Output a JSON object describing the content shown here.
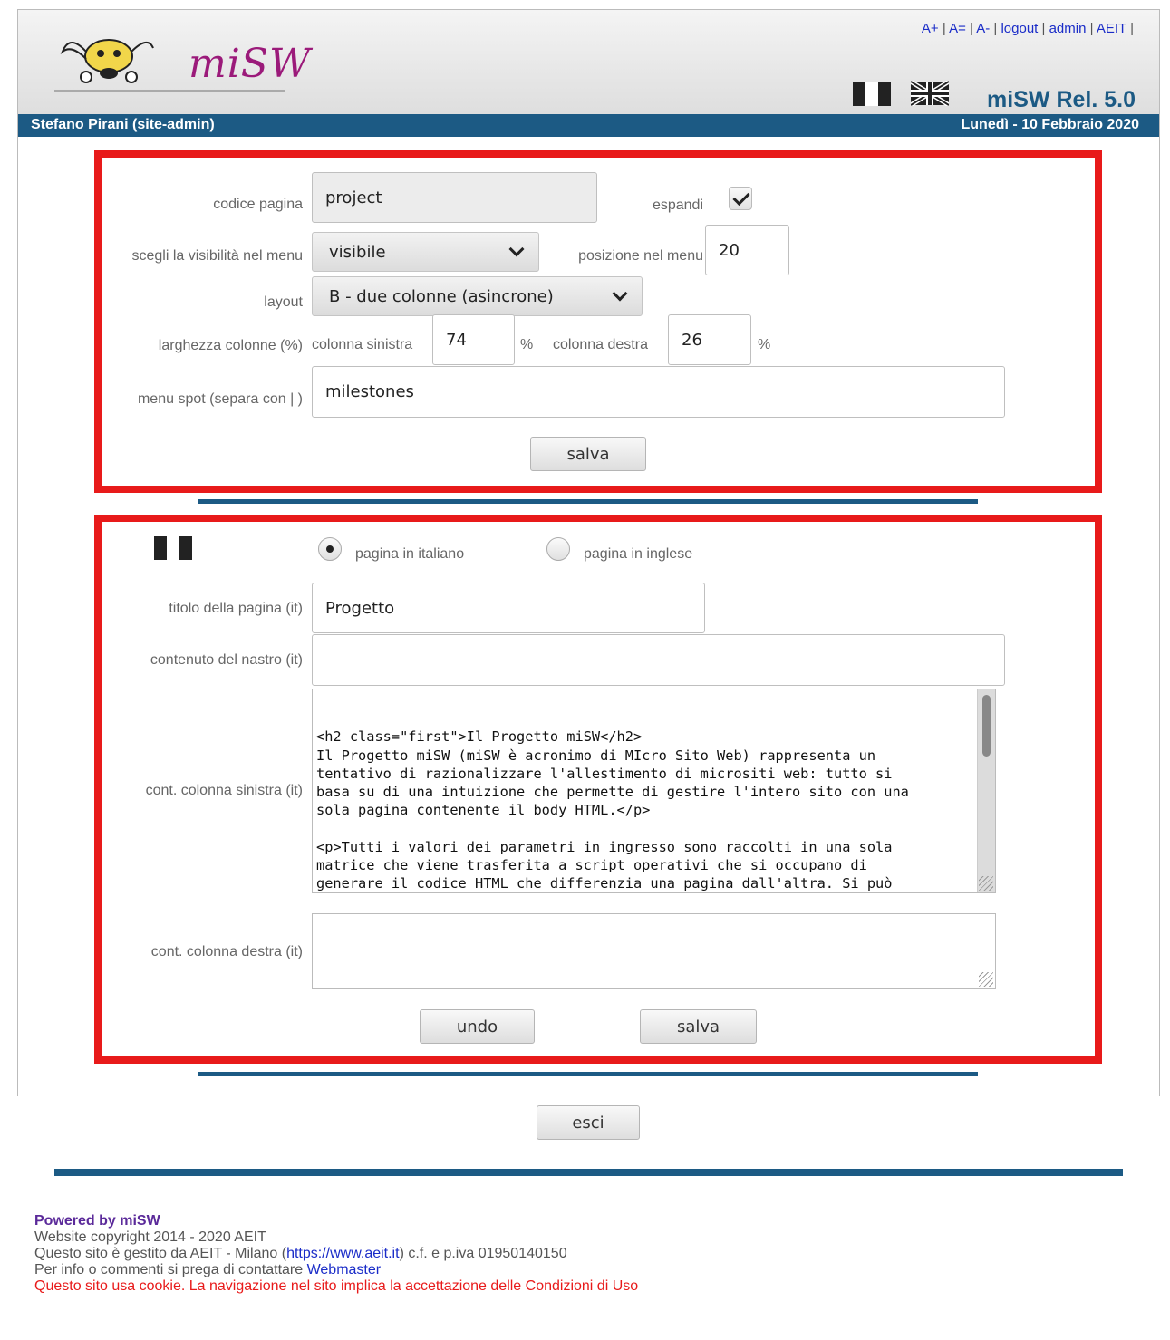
{
  "header": {
    "logo_text": "miSW",
    "links": [
      "A+",
      "A=",
      "A-",
      "logout",
      "admin",
      "AEIT"
    ],
    "release": "miSW Rel. 5.0"
  },
  "userbar": {
    "user": "Stefano Pirani (site-admin)",
    "date": "Lunedì - 10 Febbraio 2020"
  },
  "settings": {
    "page_code_label": "codice pagina",
    "page_code_value": "project",
    "expand_label": "espandi",
    "expand_checked": true,
    "visibility_label": "scegli la visibilità nel menu",
    "visibility_value": "visibile",
    "menu_position_label": "posizione nel menu",
    "menu_position_value": "20",
    "layout_label": "layout",
    "layout_value": "B - due colonne (asincrone)",
    "column_width_label": "larghezza colonne (%)",
    "left_column_label": "colonna sinistra",
    "left_column_value": "74",
    "percent": "%",
    "right_column_label": "colonna destra",
    "right_column_value": "26",
    "menu_spot_label": "menu spot (separa con | )",
    "menu_spot_value": "milestones",
    "save_label": "salva"
  },
  "content": {
    "radio_it_label": "pagina in italiano",
    "radio_en_label": "pagina in inglese",
    "selected_language": "it",
    "title_label": "titolo della pagina (it)",
    "title_value": "Progetto",
    "ribbon_label": "contenuto del nastro  (it)",
    "ribbon_value": "",
    "left_content_label": "cont. colonna sinistra (it)",
    "left_content_value": "<h2 class=\"first\">Il Progetto miSW</h2>\nIl Progetto miSW (miSW è acronimo di MIcro Sito Web) rappresenta un\ntentativo di razionalizzare l'allestimento di micrositi web: tutto si\nbasa su di una intuizione che permette di gestire l'intero sito con una\nsola pagina contenente il body HTML.</p>\n\n<p>Tutti i valori dei parametri in ingresso sono raccolti in una sola\nmatrice che viene trasferita a script operativi che si occupano di\ngenerare il codice HTML che differenzia una pagina dall'altra. Si può\naffermare che nel Progetto miSW c'è un programma (che parla in PHP) che\nchiede aiuto ad altri programmi (anch'essi in PHP)  per generare un grar",
    "right_content_label": "cont. colonna destra (it)",
    "right_content_value": "",
    "undo_label": "undo",
    "save_label": "salva"
  },
  "exit_label": "esci",
  "footer": {
    "powered": "Powered by miSW",
    "copyright": "Website copyright 2014 - 2020 AEIT",
    "managed_prefix": "Questo sito è gestito da AEIT - Milano (",
    "managed_link": "https://www.aeit.it",
    "managed_suffix": ") c.f. e p.iva 01950140150",
    "contact_prefix": "Per info o commenti si prega di contattare ",
    "contact_link": "Webmaster",
    "cookie": "Questo sito usa cookie. La navigazione nel sito implica la accettazione delle Condizioni di Uso"
  },
  "colors": {
    "accent_blue": "#1c5a84",
    "highlight_red": "#e81a1a",
    "link_blue": "#1a2cc8"
  }
}
